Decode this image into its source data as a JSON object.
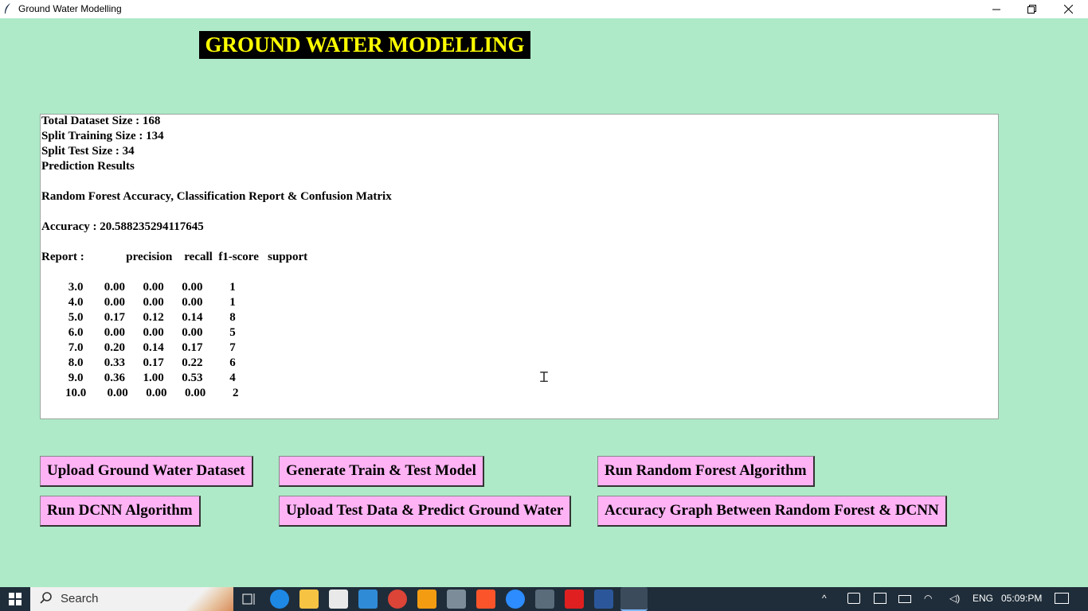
{
  "window": {
    "title": "Ground Water Modelling",
    "icon": "feather-icon"
  },
  "heading": "GROUND WATER MODELLING",
  "output": {
    "lines": [
      "Total Dataset Size : 168",
      "Split Training Size : 134",
      "Split Test Size : 34",
      "Prediction Results",
      "",
      "Random Forest Accuracy, Classification Report & Confusion Matrix",
      "",
      "Accuracy : 20.588235294117645",
      "",
      "Report :              precision    recall  f1-score   support",
      "",
      "         3.0       0.00      0.00      0.00         1",
      "         4.0       0.00      0.00      0.00         1",
      "         5.0       0.17      0.12      0.14         8",
      "         6.0       0.00      0.00      0.00         5",
      "         7.0       0.20      0.14      0.17         7",
      "         8.0       0.33      0.17      0.22         6",
      "         9.0       0.36      1.00      0.53         4",
      "        10.0       0.00      0.00      0.00         2"
    ]
  },
  "buttons": {
    "upload_dataset": "Upload Ground Water Dataset",
    "generate_model": "Generate Train & Test Model",
    "run_rf": "Run Random Forest Algorithm",
    "run_dcnn": "Run DCNN Algorithm",
    "upload_test": "Upload Test Data & Predict Ground Water",
    "accuracy_graph": "Accuracy Graph Between Random Forest & DCNN"
  },
  "taskbar": {
    "search_placeholder": "Search",
    "language": "ENG",
    "time": "05:09:PM"
  },
  "colors": {
    "background": "#aeeac8",
    "heading_bg": "#000000",
    "heading_fg": "#ffff00",
    "button_bg": "#ffb3f5"
  }
}
